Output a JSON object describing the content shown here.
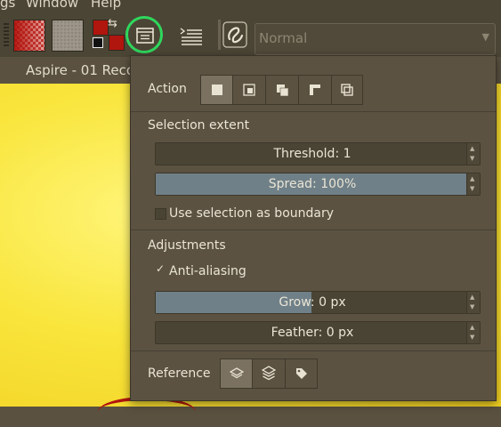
{
  "menubar": {
    "items": [
      "gs",
      "Window",
      "Help"
    ]
  },
  "toolbar": {
    "blending_mode": "Normal"
  },
  "document": {
    "title": "Aspire - 01 Reco"
  },
  "popup": {
    "action": {
      "label": "Action",
      "modes": [
        "replace-mode-icon",
        "intersect-mode-icon",
        "add-mode-icon",
        "subtract-mode-icon",
        "symmetric-difference-mode-icon"
      ],
      "active_index": 0
    },
    "selection_extent": {
      "heading": "Selection extent",
      "threshold": {
        "text": "Threshold: 1",
        "fraction": 0
      },
      "spread": {
        "text": "Spread: 100%",
        "fraction": 1.0
      },
      "use_boundary": {
        "label": "Use selection as boundary",
        "checked": false
      }
    },
    "adjustments": {
      "heading": "Adjustments",
      "anti_aliasing": {
        "label": "Anti-aliasing",
        "checked": true,
        "mark": "✓"
      },
      "grow": {
        "text": "Grow: 0 px",
        "fraction": 0.5
      },
      "feather": {
        "text": "Feather: 0 px",
        "fraction": 0
      }
    },
    "reference": {
      "label": "Reference",
      "options": [
        "current-layer-icon",
        "all-layers-icon",
        "color-labeled-layers-icon"
      ],
      "active_index": 0
    }
  },
  "colors": {
    "accent_circle": "#2fd75d",
    "slider_fill": "#6f8088",
    "foreground": "#b0150e",
    "canvas": "#f9e53c"
  }
}
